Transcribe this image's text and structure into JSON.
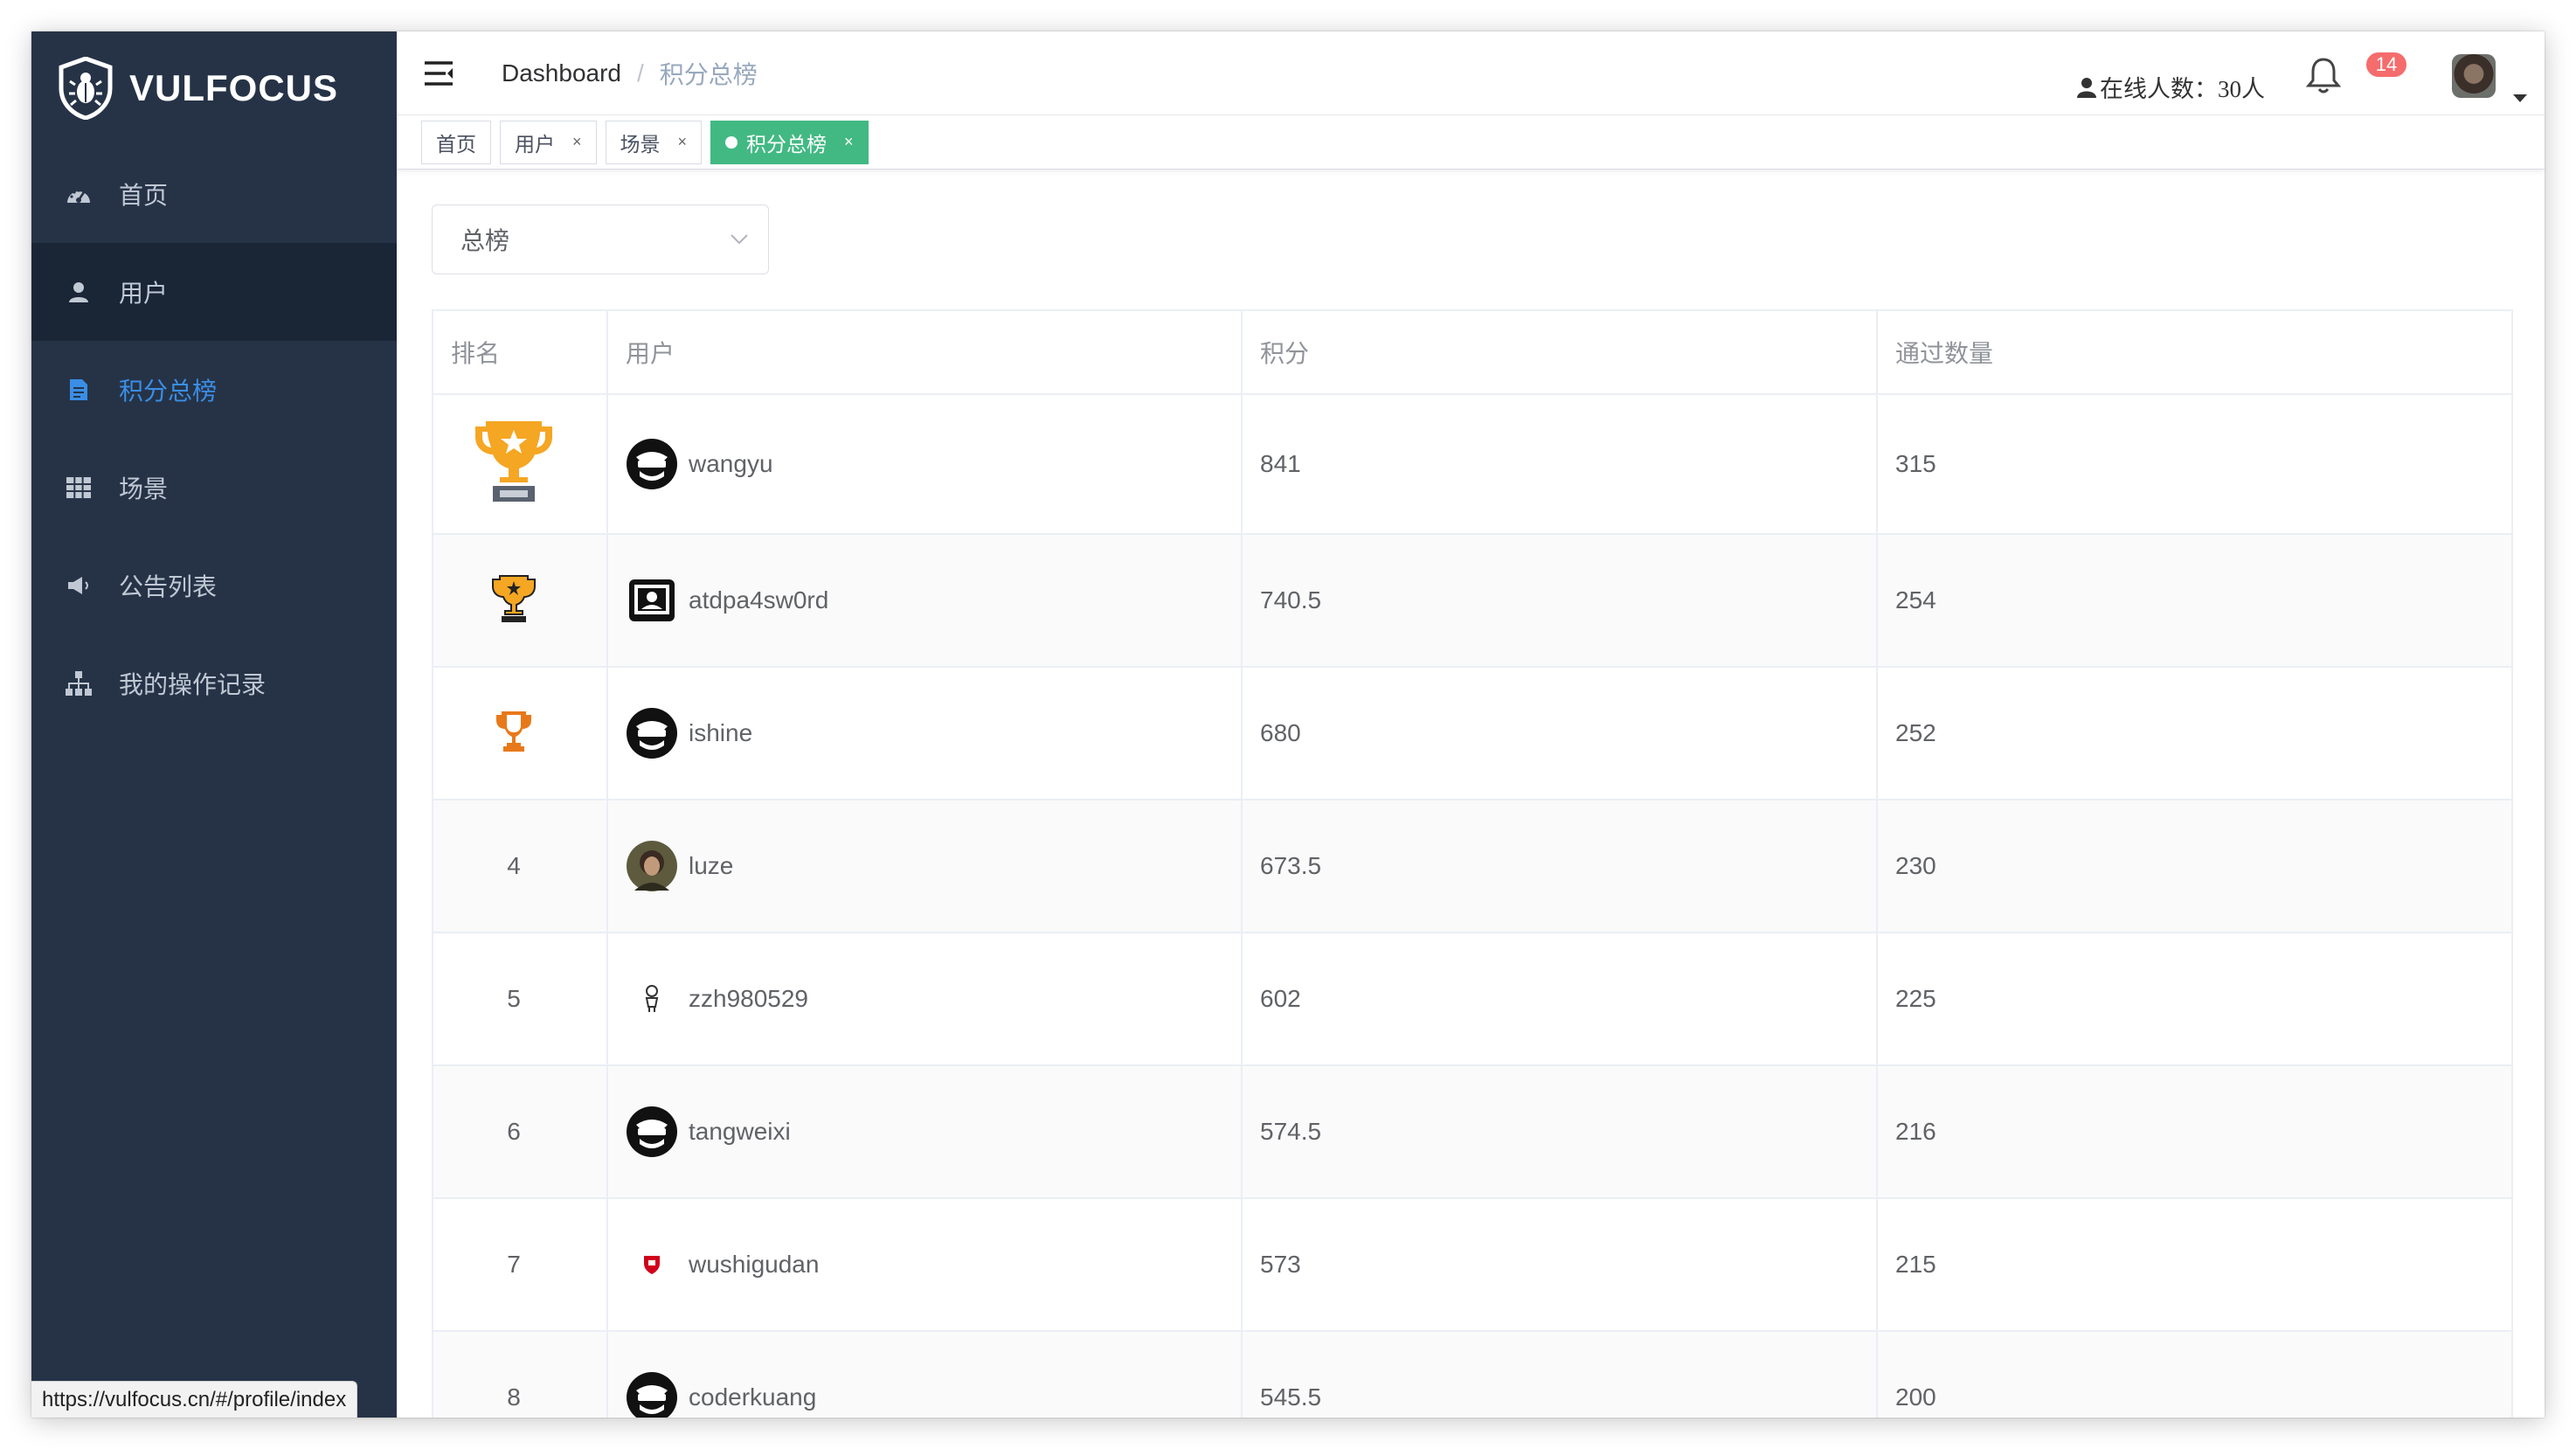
{
  "app": {
    "name": "VULFOCUS"
  },
  "sidebar": {
    "items": [
      {
        "label": "首页",
        "icon": "dashboard-icon"
      },
      {
        "label": "用户",
        "icon": "user-icon"
      },
      {
        "label": "积分总榜",
        "icon": "document-icon",
        "active": true
      },
      {
        "label": "场景",
        "icon": "grid-icon"
      },
      {
        "label": "公告列表",
        "icon": "megaphone-icon"
      },
      {
        "label": "我的操作记录",
        "icon": "sitemap-icon"
      }
    ]
  },
  "status_url": "https://vulfocus.cn/#/profile/index",
  "navbar": {
    "breadcrumb_root": "Dashboard",
    "breadcrumb_sep": "/",
    "breadcrumb_current": "积分总榜",
    "online_label": "在线人数：30人",
    "notification_count": "14"
  },
  "tags": [
    {
      "label": "首页",
      "closable": false
    },
    {
      "label": "用户",
      "closable": true
    },
    {
      "label": "场景",
      "closable": true
    },
    {
      "label": "积分总榜",
      "closable": true,
      "active": true
    }
  ],
  "tag_close": "×",
  "filter": {
    "selected": "总榜"
  },
  "table": {
    "headers": [
      "排名",
      "用户",
      "积分",
      "通过数量"
    ],
    "rows": [
      {
        "rank": "",
        "rank_icon": "gold-trophy-icon",
        "user": "wangyu",
        "avatar": "hacker-avatar",
        "score": "841",
        "passed": "315"
      },
      {
        "rank": "",
        "rank_icon": "silver-trophy-icon",
        "user": "atdpa4sw0rd",
        "avatar": "monitor-avatar",
        "score": "740.5",
        "passed": "254"
      },
      {
        "rank": "",
        "rank_icon": "bronze-trophy-icon",
        "user": "ishine",
        "avatar": "hacker-avatar",
        "score": "680",
        "passed": "252"
      },
      {
        "rank": "4",
        "user": "luze",
        "avatar": "photo-avatar",
        "score": "673.5",
        "passed": "230"
      },
      {
        "rank": "5",
        "user": "zzh980529",
        "avatar": "figure-avatar",
        "score": "602",
        "passed": "225"
      },
      {
        "rank": "6",
        "user": "tangweixi",
        "avatar": "hacker-avatar",
        "score": "574.5",
        "passed": "216"
      },
      {
        "rank": "7",
        "user": "wushigudan",
        "avatar": "shield-avatar",
        "score": "573",
        "passed": "215"
      },
      {
        "rank": "8",
        "user": "coderkuang",
        "avatar": "hacker-avatar",
        "score": "545.5",
        "passed": "200"
      }
    ]
  },
  "colors": {
    "sidebar_bg": "#263347",
    "sidebar_active": "#3a8ee6",
    "tag_active": "#42b983",
    "badge": "#f56c6c"
  }
}
